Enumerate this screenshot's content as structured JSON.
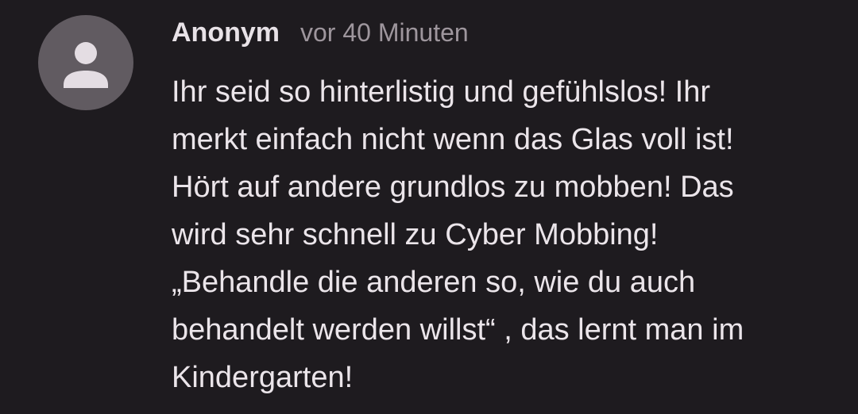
{
  "comment": {
    "author": "Anonym",
    "timestamp": "vor 40 Minuten",
    "avatar_icon": "person-icon",
    "lines": [
      "Ihr seid so hinterlistig und gefühlslos! Ihr",
      "merkt einfach nicht wenn das Glas voll ist!",
      "Hört auf andere grundlos zu mobben! Das",
      "wird sehr schnell zu Cyber Mobbing!",
      "„Behandle die anderen so, wie du auch",
      "behandelt werden willst“ , das lernt man im",
      "Kindergarten!"
    ]
  },
  "colors": {
    "background": "#1e1b1f",
    "avatar_bg": "#615b61",
    "avatar_glyph": "#e4dde3",
    "author": "#e8e2e7",
    "timestamp": "#9e969d",
    "text": "#ebe5ea"
  }
}
